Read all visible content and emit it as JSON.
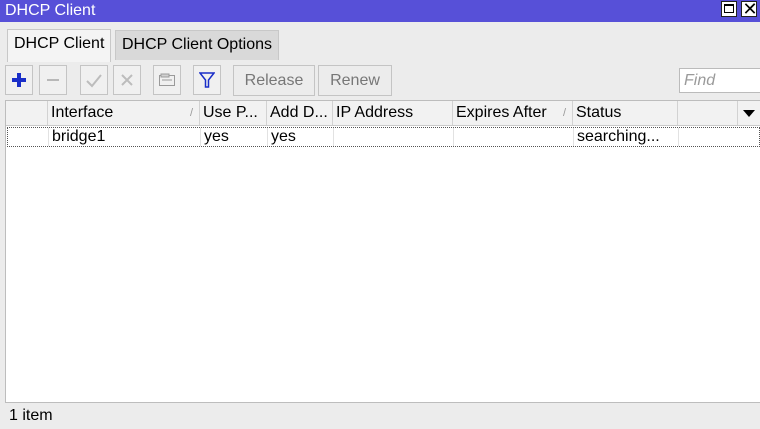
{
  "window": {
    "title": "DHCP Client",
    "titlebar_color": "#5750d8"
  },
  "tabs": [
    {
      "label": "DHCP Client",
      "active": true
    },
    {
      "label": "DHCP Client Options",
      "active": false
    }
  ],
  "toolbar": {
    "add_icon": "plus-icon",
    "remove_icon": "minus-icon",
    "enable_icon": "check-icon",
    "disable_icon": "x-icon",
    "comment_icon": "comment-icon",
    "filter_icon": "filter-icon",
    "release_label": "Release",
    "renew_label": "Renew",
    "find_placeholder": "Find"
  },
  "table": {
    "columns": [
      "Interface",
      "Use P...",
      "Add D...",
      "IP Address",
      "Expires After",
      "Status"
    ],
    "rows": [
      {
        "interface": "bridge1",
        "use_peer": "yes",
        "add_default": "yes",
        "ip_address": "",
        "expires_after": "",
        "status": "searching..."
      }
    ]
  },
  "status_bar": {
    "count_text": "1 item"
  }
}
